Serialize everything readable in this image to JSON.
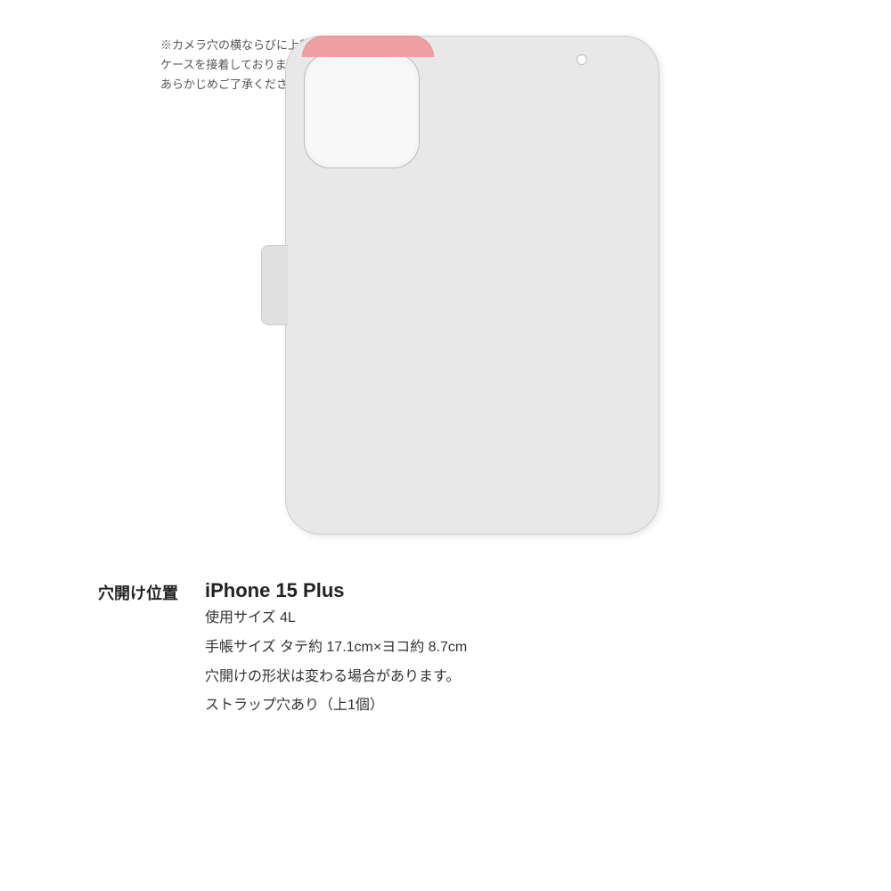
{
  "notice": {
    "line1": "※カメラ穴の横ならびに上部は",
    "line2": "ケースを接着しておりません。",
    "line3": "あらかじめご了承ください。"
  },
  "label": {
    "hole_position": "穴開け位置"
  },
  "product": {
    "model": "iPhone 15 Plus",
    "size_label": "使用サイズ 4L",
    "notebook_size": "手帳サイズ タテ約 17.1cm×ヨコ約 8.7cm",
    "hole_shape": "穴開けの形状は変わる場合があります。",
    "strap": "ストラップ穴あり（上1個）"
  },
  "colors": {
    "background": "#ffffff",
    "case_body": "#e8e8e8",
    "case_border": "#cccccc",
    "camera_cutout": "#f5f5f5",
    "side_tab": "#e0e0e0",
    "fold_accent": "#f0a0a0",
    "text_notice": "#555555",
    "text_main": "#222222",
    "text_info": "#333333"
  }
}
